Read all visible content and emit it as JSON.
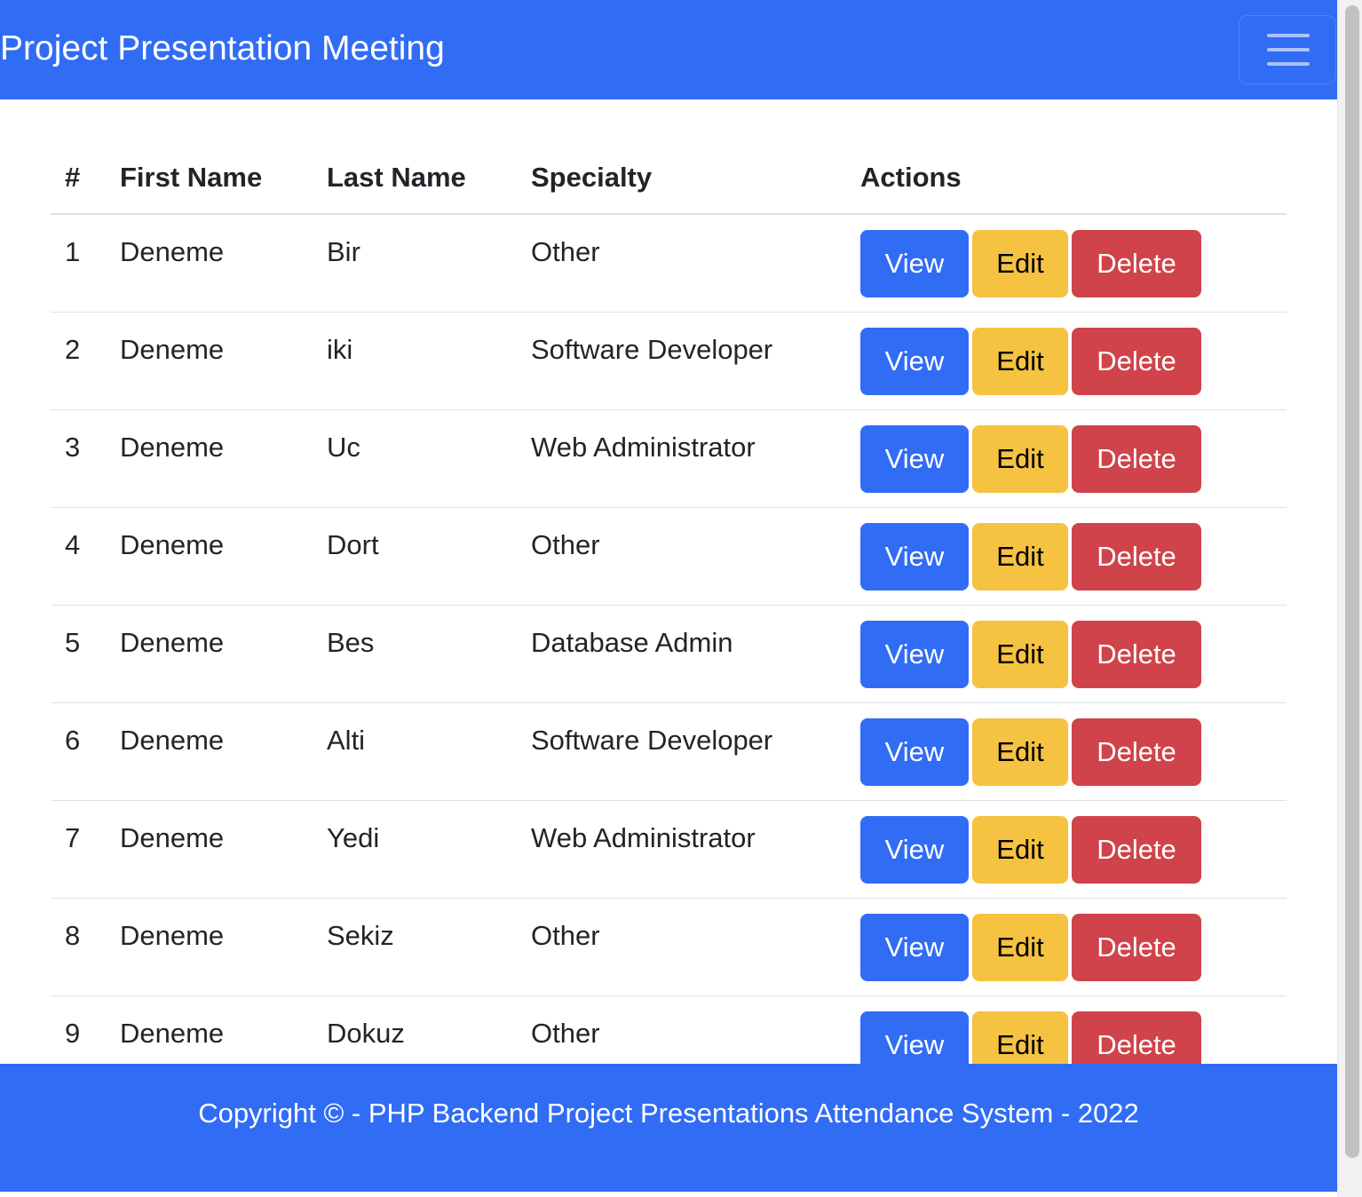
{
  "navbar": {
    "title": "Project Presentation Meeting",
    "toggle_icon": "hamburger-icon"
  },
  "table": {
    "headers": [
      "#",
      "First Name",
      "Last Name",
      "Specialty",
      "Actions"
    ],
    "rows": [
      {
        "id": "1",
        "first": "Deneme",
        "last": "Bir",
        "specialty": "Other"
      },
      {
        "id": "2",
        "first": "Deneme",
        "last": "iki",
        "specialty": "Software Developer"
      },
      {
        "id": "3",
        "first": "Deneme",
        "last": "Uc",
        "specialty": "Web Administrator"
      },
      {
        "id": "4",
        "first": "Deneme",
        "last": "Dort",
        "specialty": "Other"
      },
      {
        "id": "5",
        "first": "Deneme",
        "last": "Bes",
        "specialty": "Database Admin"
      },
      {
        "id": "6",
        "first": "Deneme",
        "last": "Alti",
        "specialty": "Software Developer"
      },
      {
        "id": "7",
        "first": "Deneme",
        "last": "Yedi",
        "specialty": "Web Administrator"
      },
      {
        "id": "8",
        "first": "Deneme",
        "last": "Sekiz",
        "specialty": "Other"
      },
      {
        "id": "9",
        "first": "Deneme",
        "last": "Dokuz",
        "specialty": "Other"
      }
    ],
    "actions": {
      "view": "View",
      "edit": "Edit",
      "delete": "Delete"
    }
  },
  "footer": {
    "text": "Copyright © - PHP Backend Project Presentations Attendance System - 2022"
  },
  "colors": {
    "primary": "#316cf4",
    "warning": "#f5c242",
    "danger": "#d0434a"
  }
}
